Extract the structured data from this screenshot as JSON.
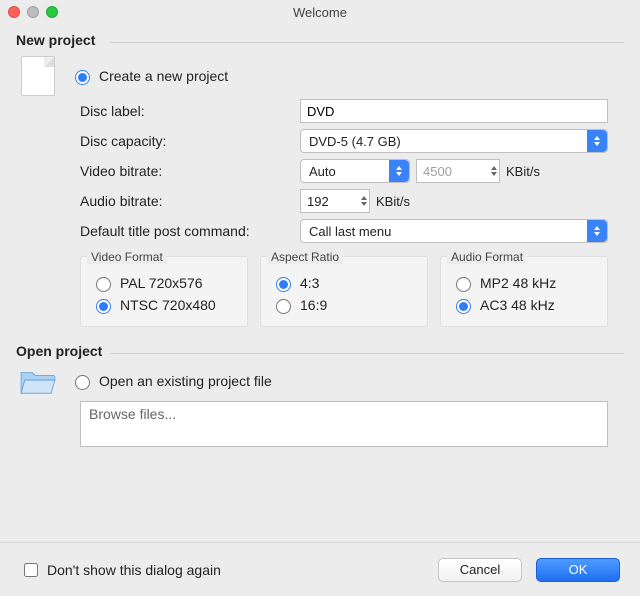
{
  "window": {
    "title": "Welcome"
  },
  "new_project": {
    "header": "New project",
    "create_label": "Create a new project",
    "disc_label_label": "Disc label:",
    "disc_label_value": "DVD",
    "disc_capacity_label": "Disc capacity:",
    "disc_capacity_value": "DVD-5 (4.7 GB)",
    "video_bitrate_label": "Video bitrate:",
    "video_bitrate_mode": "Auto",
    "video_bitrate_value": "4500",
    "video_bitrate_unit": "KBit/s",
    "audio_bitrate_label": "Audio bitrate:",
    "audio_bitrate_value": "192",
    "audio_bitrate_unit": "KBit/s",
    "post_command_label": "Default title post command:",
    "post_command_value": "Call last menu",
    "video_format": {
      "title": "Video Format",
      "pal": "PAL 720x576",
      "ntsc": "NTSC 720x480"
    },
    "aspect_ratio": {
      "title": "Aspect Ratio",
      "r43": "4:3",
      "r169": "16:9"
    },
    "audio_format": {
      "title": "Audio Format",
      "mp2": "MP2 48 kHz",
      "ac3": "AC3 48 kHz"
    }
  },
  "open_project": {
    "header": "Open project",
    "open_label": "Open an existing project file",
    "browse_placeholder": "Browse files..."
  },
  "footer": {
    "dont_show": "Don't show this dialog again",
    "cancel": "Cancel",
    "ok": "OK"
  }
}
